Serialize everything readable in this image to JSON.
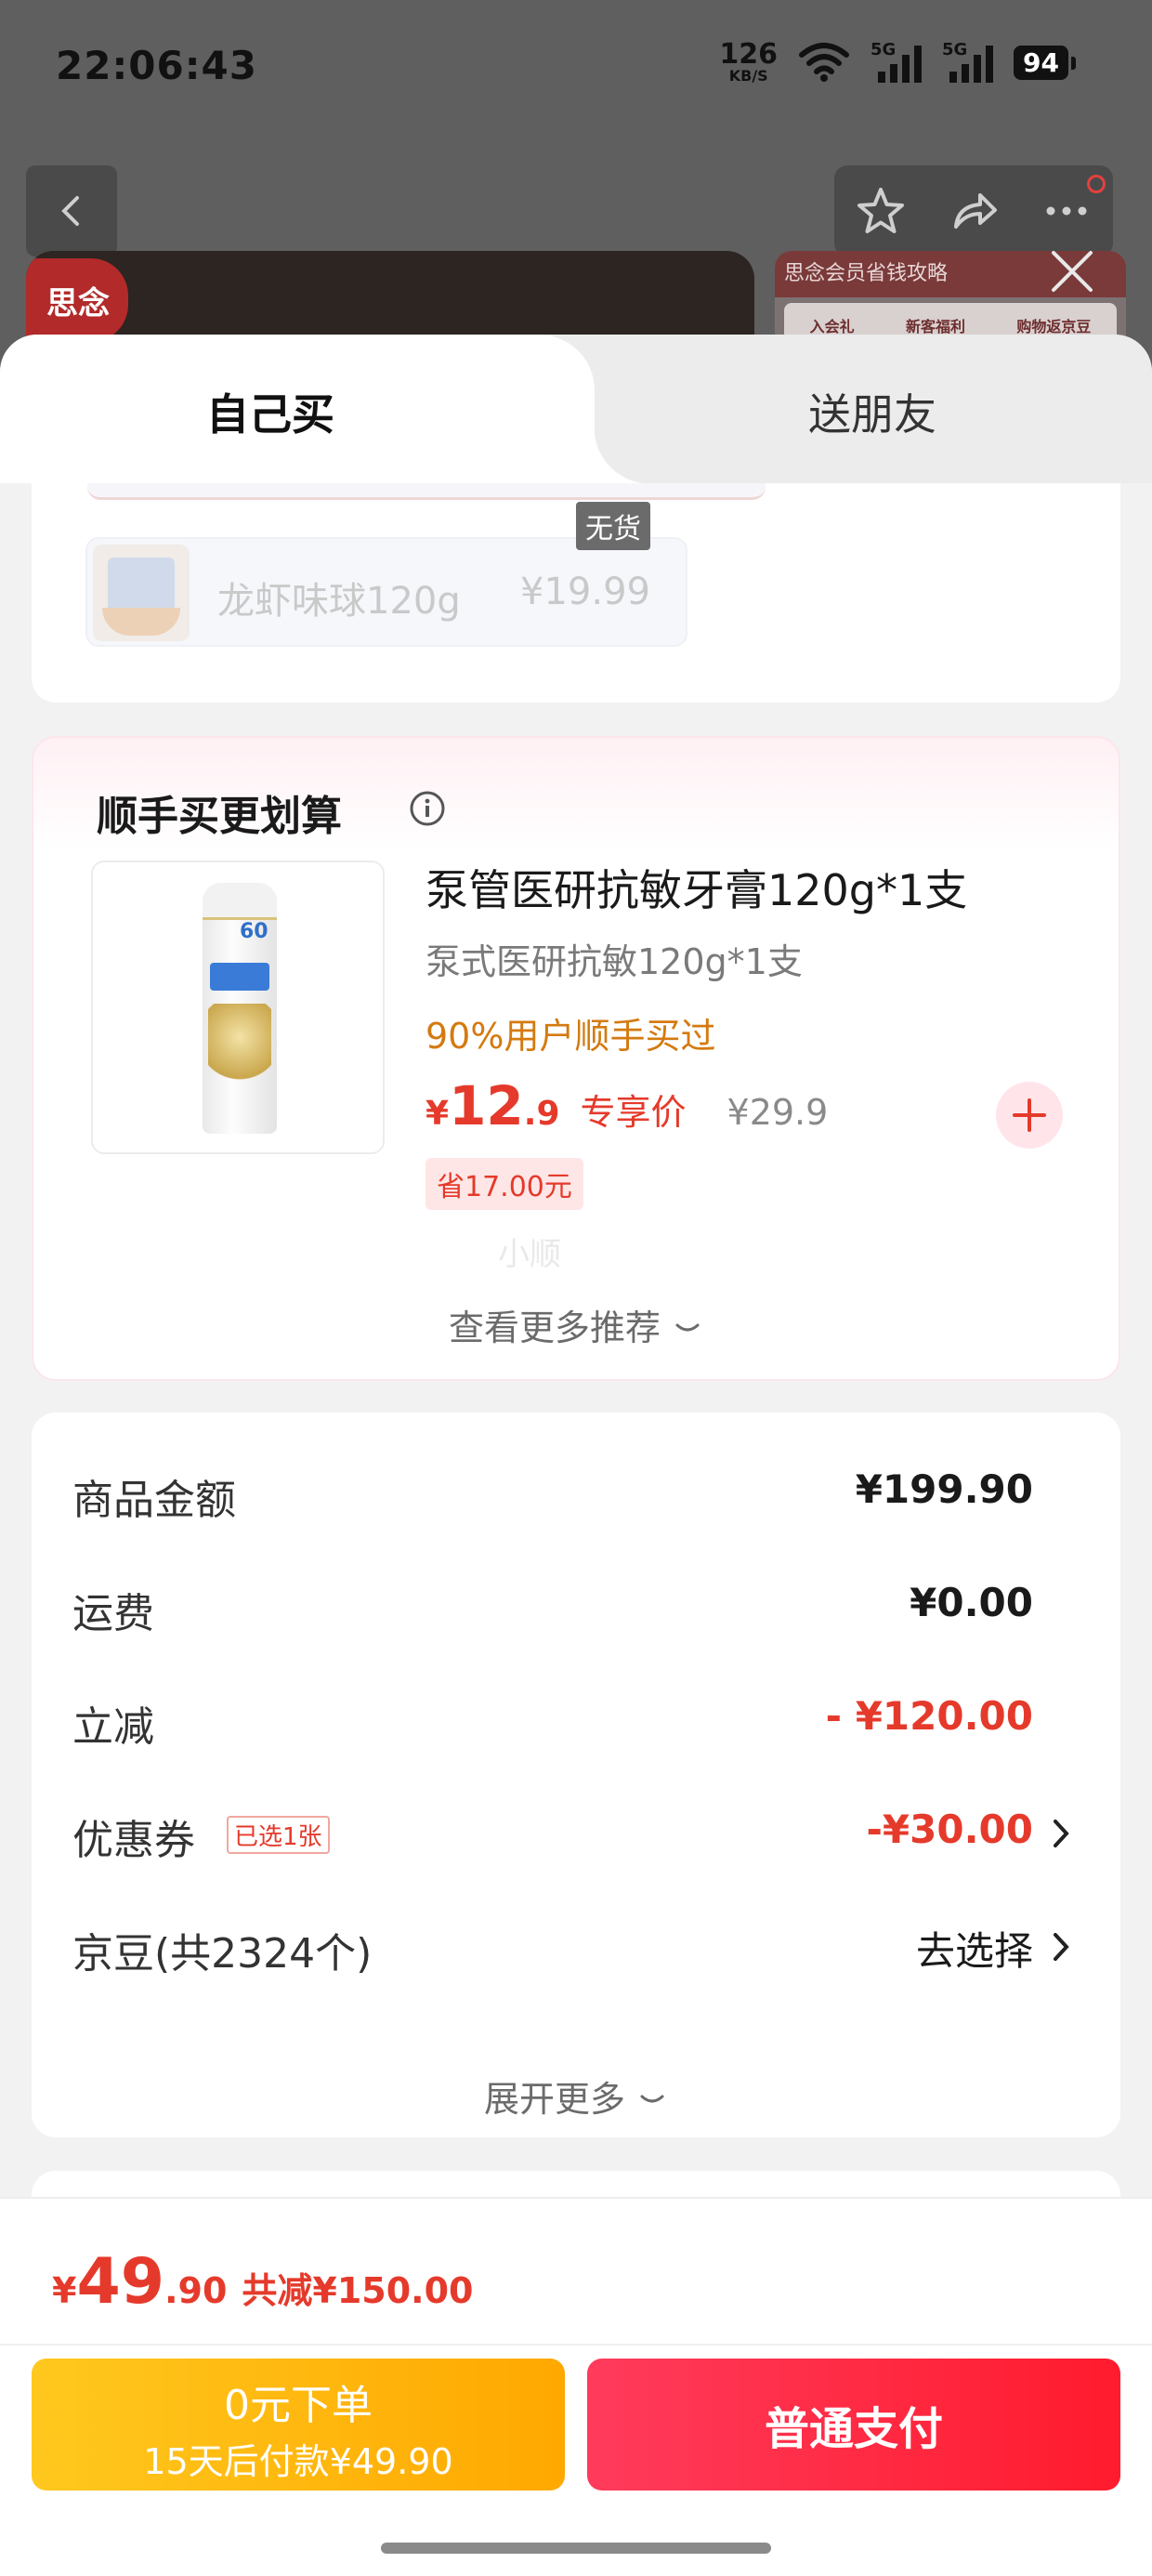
{
  "status_bar": {
    "time": "22:06:43",
    "net_speed": "126",
    "net_unit": "KB/S",
    "signal1_label": "5G",
    "signal2_label": "5G",
    "battery": "94"
  },
  "background": {
    "banner_logo": "思念",
    "promo_head": "思念会员省钱攻略",
    "promo_cells": [
      "入会礼",
      "新客福利",
      "购物返京豆"
    ]
  },
  "tabs": [
    {
      "label": "自己买",
      "active": true
    },
    {
      "label": "送朋友",
      "active": false
    }
  ],
  "items_card": {
    "gift_name": "龙虾味球120g",
    "gift_price": "¥19.99",
    "out_of_stock": "无货"
  },
  "addon_card": {
    "title": "顺手买更划算",
    "product_name": "泵管医研抗敏牙膏120g*1支",
    "product_spec": "泵式医研抗敏120g*1支",
    "social_tip": "90%用户顺手买过",
    "price_currency": "¥",
    "price_int": "12",
    "price_dec": ".9",
    "price_tag": "专享价",
    "original_price": "¥29.9",
    "save_label": "省17.00元",
    "watermark": "小顺",
    "see_more": "查看更多推荐"
  },
  "summary": {
    "rows": [
      {
        "label": "商品金额",
        "value": "¥199.90"
      },
      {
        "label": "运费",
        "value": "¥0.00"
      },
      {
        "label": "立减",
        "value": "- ¥120.00"
      },
      {
        "label": "优惠券",
        "badge": "已选1张",
        "value": "-¥30.00"
      },
      {
        "label": "京豆(共2324个)",
        "value": "去选择"
      }
    ],
    "expand_more": "展开更多"
  },
  "bottom_bar": {
    "total_currency": "¥",
    "total_int": "49",
    "total_dec": ".90",
    "total_reduce": "共减¥150.00",
    "pay_later_line1": "0元下单",
    "pay_later_line2": "15天后付款¥49.90",
    "pay_now": "普通支付"
  },
  "colors": {
    "accent_red": "#e53a2b",
    "pay_later_gradient": [
      "#ffc81e",
      "#ffa800"
    ],
    "pay_now_gradient": [
      "#ff3b5c",
      "#ff1b2d"
    ],
    "tip_orange": "#d47a10"
  }
}
